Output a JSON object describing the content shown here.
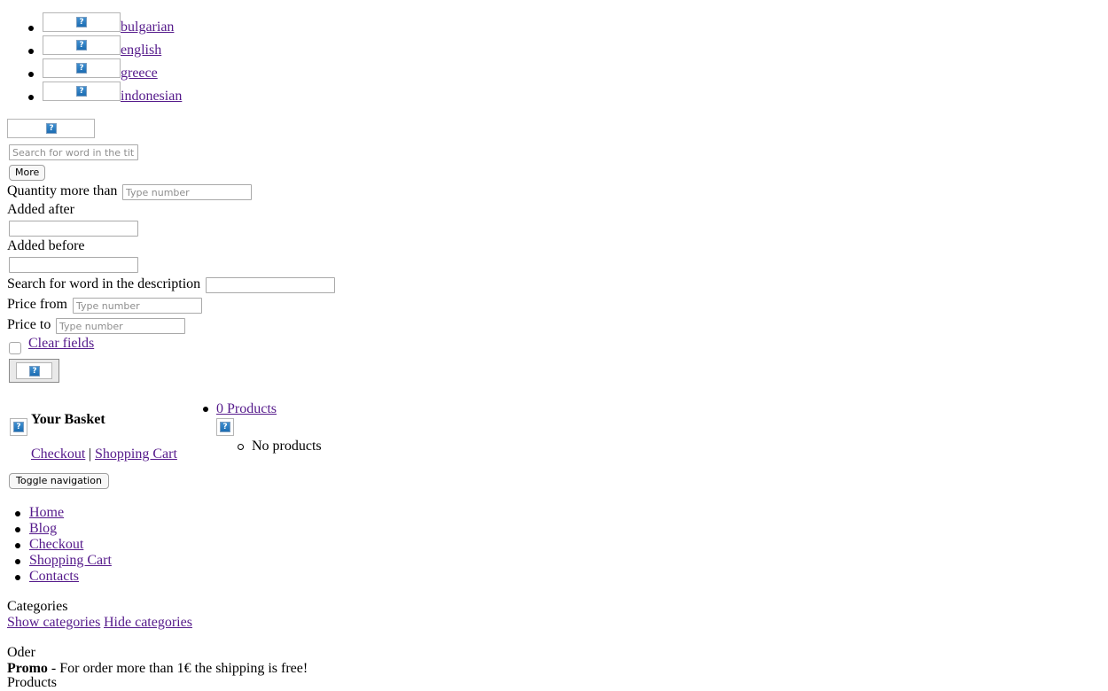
{
  "languages": [
    {
      "label": "bulgarian"
    },
    {
      "label": "english"
    },
    {
      "label": "greece"
    },
    {
      "label": "indonesian"
    }
  ],
  "search": {
    "title_placeholder": "Search for word in the title",
    "more_label": "More",
    "quantity_label": "Quantity more than",
    "quantity_placeholder": "Type number",
    "added_after_label": "Added after",
    "added_before_label": "Added before",
    "description_label": "Search for word in the description",
    "price_from_label": "Price from",
    "price_from_placeholder": "Type number",
    "price_to_label": "Price to",
    "price_to_placeholder": "Type number",
    "clear_fields_label": "Clear fields"
  },
  "basket": {
    "title": "Your Basket",
    "checkout_label": "Checkout",
    "separator": "|",
    "shopping_cart_label": "Shopping Cart",
    "products_count_label": "0 Products",
    "no_products_label": "No products"
  },
  "nav": {
    "toggle_label": "Toggle navigation",
    "items": [
      {
        "label": "Home"
      },
      {
        "label": "Blog"
      },
      {
        "label": "Checkout"
      },
      {
        "label": "Shopping Cart"
      },
      {
        "label": "Contacts"
      }
    ]
  },
  "categories": {
    "heading": "Categories",
    "show_label": "Show categories",
    "hide_label": "Hide categories"
  },
  "order": {
    "heading": "Oder",
    "promo_label": "Promo",
    "promo_text": " - For order more than 1€ the shipping is free!"
  },
  "products": {
    "heading": "Products"
  }
}
